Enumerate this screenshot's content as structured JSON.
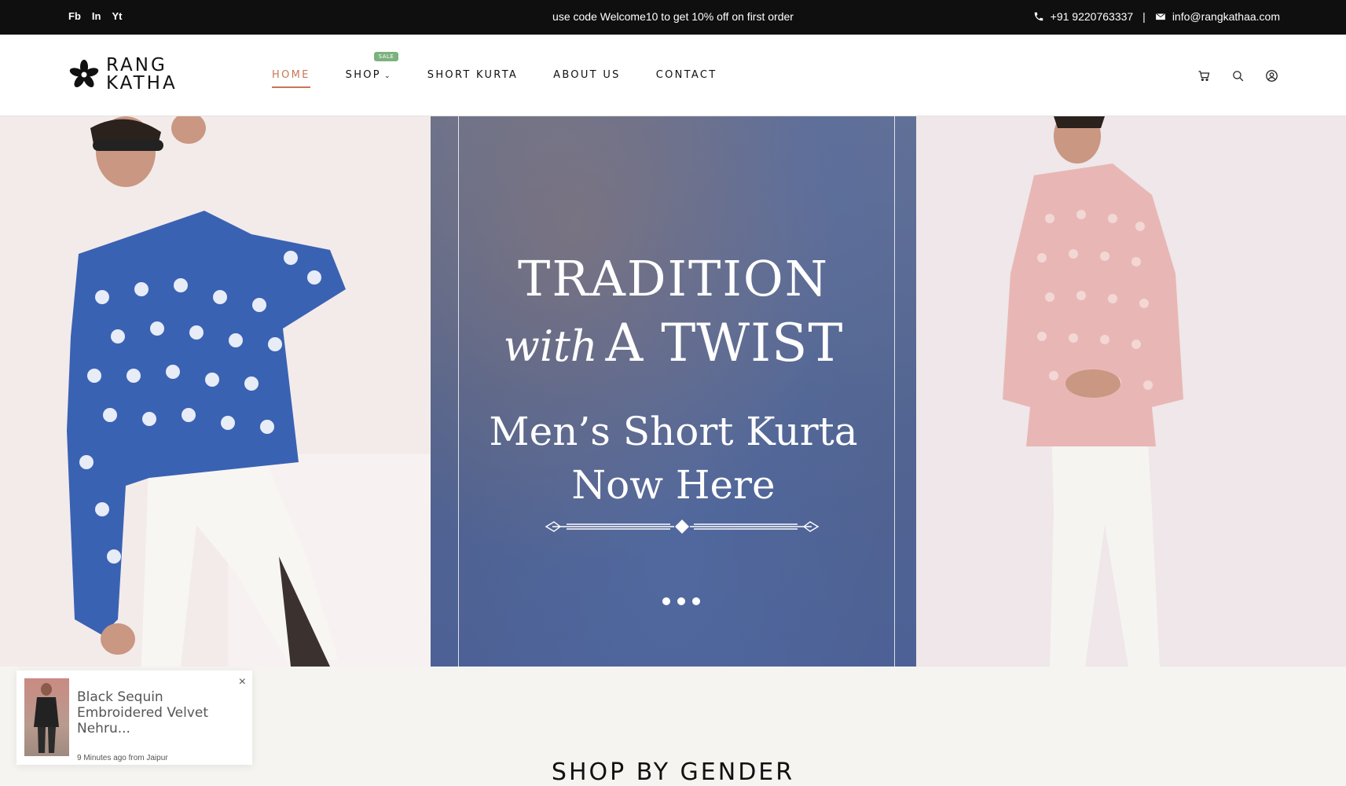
{
  "topbar": {
    "social": [
      "Fb",
      "In",
      "Yt"
    ],
    "promo": "use code Welcome10 to get 10% off on first order",
    "phone": "+91 9220763337",
    "separator": "|",
    "email": "info@rangkathaa.com"
  },
  "logo": {
    "line1": "RANG",
    "line2": "KATHA"
  },
  "nav": {
    "items": [
      {
        "label": "HOME"
      },
      {
        "label": "SHOP",
        "badge": "SALE"
      },
      {
        "label": "SHORT KURTA"
      },
      {
        "label": "ABOUT US"
      },
      {
        "label": "CONTACT"
      }
    ]
  },
  "hero": {
    "line1": "TRADITION",
    "script": "with",
    "line2": "A TWIST",
    "line3": "Men’s Short Kurta",
    "line4": "Now Here"
  },
  "toast": {
    "title": "Black Sequin Embroidered Velvet Nehru...",
    "meta": "9 Minutes ago from Jaipur",
    "close": "×"
  },
  "section": {
    "title": "SHOP BY GENDER"
  },
  "colors": {
    "accent": "#c8765a",
    "sale_badge": "#7bb27d",
    "topbar": "#0f0f0f"
  }
}
